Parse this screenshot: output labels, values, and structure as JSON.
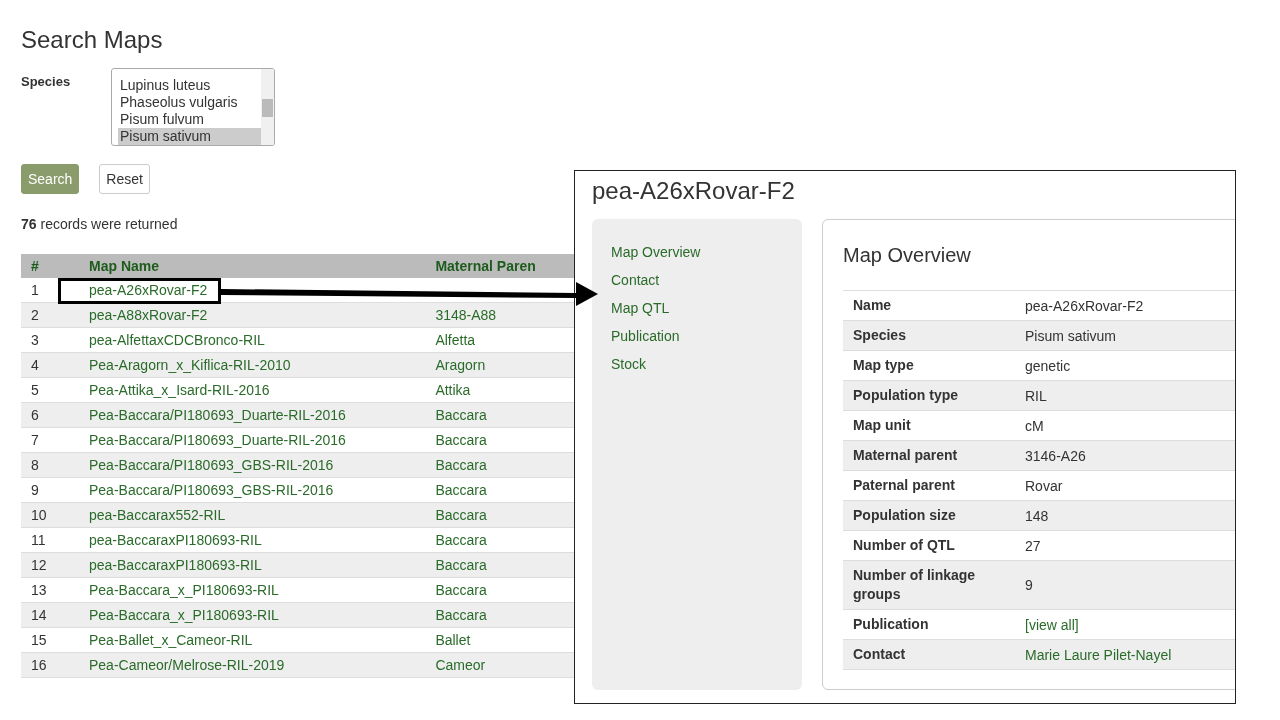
{
  "page_title": "Search Maps",
  "species_filter": {
    "label": "Species",
    "options": [
      {
        "label": "Lupinus luteus",
        "selected": false
      },
      {
        "label": "Phaseolus vulgaris",
        "selected": false
      },
      {
        "label": "Pisum fulvum",
        "selected": false
      },
      {
        "label": "Pisum sativum",
        "selected": true
      }
    ]
  },
  "buttons": [
    {
      "label": "Search",
      "kind": "primary"
    },
    {
      "label": "Reset",
      "kind": "secondary"
    }
  ],
  "result_count": "**76** records were returned",
  "table": {
    "columns": [
      "#",
      "Map Name",
      "Maternal Paren"
    ],
    "rows": [
      [
        "1",
        "pea-A26xRovar-F2"
      ],
      [
        "2",
        "pea-A88xRovar-F2",
        "3148-A88"
      ],
      [
        "3",
        "pea-AlfettaxCDCBronco-RIL",
        "Alfetta"
      ],
      [
        "4",
        "Pea-Aragorn_x_Kiflica-RIL-2010",
        "Aragorn"
      ],
      [
        "5",
        "Pea-Attika_x_Isard-RIL-2016",
        "Attika"
      ],
      [
        "6",
        "Pea-Baccara/PI180693_Duarte-RIL-2016",
        "Baccara"
      ],
      [
        "7",
        "Pea-Baccara/PI180693_Duarte-RIL-2016",
        "Baccara"
      ],
      [
        "8",
        "Pea-Baccara/PI180693_GBS-RIL-2016",
        "Baccara"
      ],
      [
        "9",
        "Pea-Baccara/PI180693_GBS-RIL-2016",
        "Baccara"
      ],
      [
        "10",
        "pea-Baccarax552-RIL",
        "Baccara"
      ],
      [
        "11",
        "pea-BaccaraxPI180693-RIL",
        "Baccara"
      ],
      [
        "12",
        "pea-BaccaraxPI180693-RIL",
        "Baccara"
      ],
      [
        "13",
        "Pea-Baccara_x_PI180693-RIL",
        "Baccara"
      ],
      [
        "14",
        "Pea-Baccara_x_PI180693-RIL",
        "Baccara"
      ],
      [
        "15",
        "Pea-Ballet_x_Cameor-RIL",
        "Ballet"
      ],
      [
        "16",
        "Pea-Cameor/Melrose-RIL-2019",
        "Cameor"
      ]
    ]
  },
  "detail_inset": {
    "title": "pea-A26xRovar-F2",
    "nav": [
      "Map Overview",
      "Contact",
      "Map QTL",
      "Publication",
      "Stock"
    ],
    "section_title": "Map Overview",
    "fields": [
      {
        "label": "Name",
        "value": "pea-A26xRovar-F2",
        "kind": "text"
      },
      {
        "label": "Species",
        "value": "Pisum sativum",
        "kind": "text"
      },
      {
        "label": "Map type",
        "value": "genetic",
        "kind": "text"
      },
      {
        "label": "Population type",
        "value": "RIL",
        "kind": "text"
      },
      {
        "label": "Map unit",
        "value": "cM",
        "kind": "text"
      },
      {
        "label": "Maternal parent",
        "value": "3146-A26",
        "kind": "text"
      },
      {
        "label": "Paternal parent",
        "value": "Rovar",
        "kind": "text"
      },
      {
        "label": "Population size",
        "value": "148",
        "kind": "text"
      },
      {
        "label": "Number of QTL",
        "value": "27",
        "kind": "text"
      },
      {
        "label": "Number of linkage groups",
        "value": "9",
        "kind": "text"
      },
      {
        "label": "Publication",
        "value": "[view all]",
        "kind": "link"
      },
      {
        "label": "Contact",
        "value": "Marie Laure Pilet-Nayel",
        "kind": "link"
      }
    ]
  }
}
